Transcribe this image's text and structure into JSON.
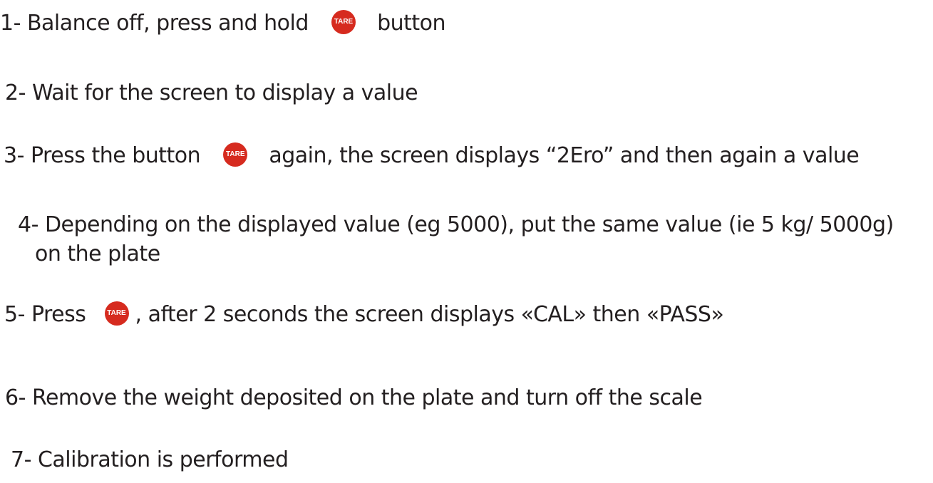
{
  "tare_button": {
    "label": "TARE",
    "color": "#d62b1f"
  },
  "steps": {
    "s1": {
      "before": "1- Balance off, press and hold",
      "after": "button"
    },
    "s2": {
      "text": "2- Wait for the screen to display a value"
    },
    "s3": {
      "before": "3- Press the button",
      "after": "again, the screen displays “2Ero” and then again a value"
    },
    "s4": {
      "line1": "4- Depending on the displayed value (eg 5000), put the same value (ie 5 kg/ 5000g)",
      "line2": "on the plate"
    },
    "s5": {
      "before": "5- Press",
      "after": ", after 2 seconds the screen displays «CAL» then «PASS»"
    },
    "s6": {
      "text": "6- Remove the weight deposited on the plate and turn off the scale"
    },
    "s7": {
      "text": "7- Calibration is performed"
    }
  }
}
